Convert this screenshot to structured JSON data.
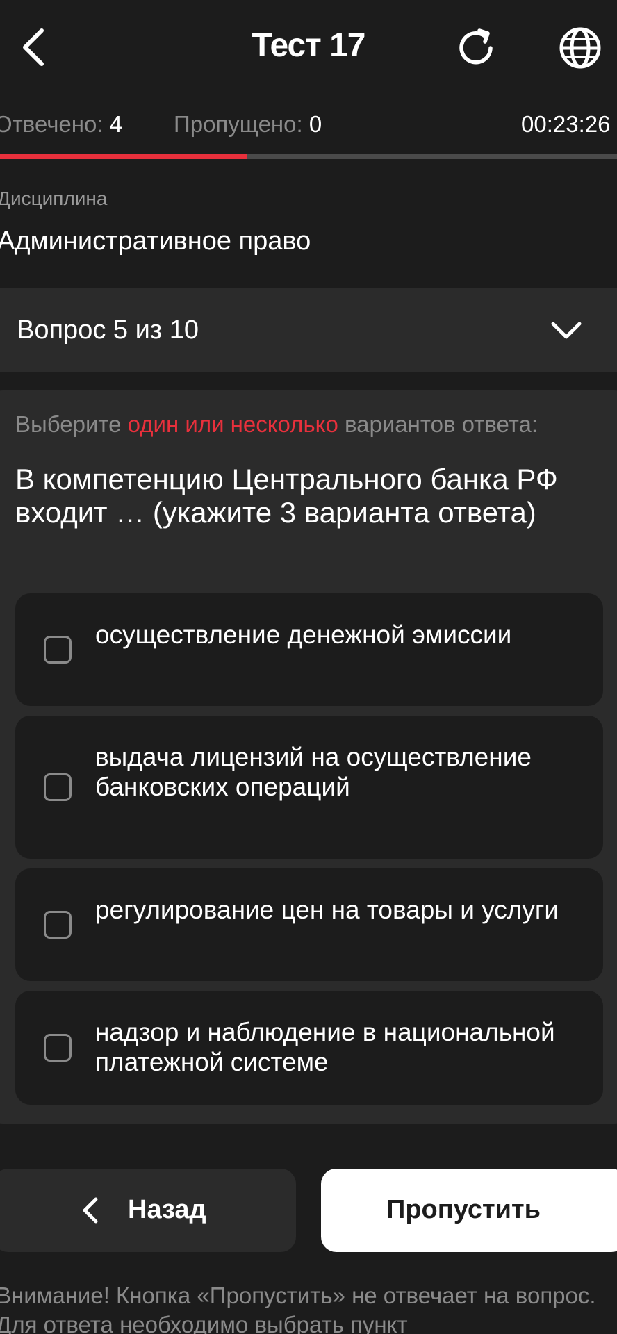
{
  "header": {
    "title": "Тест 17",
    "back_icon": "chevron-left-icon",
    "refresh_icon": "refresh-icon",
    "globe_icon": "globe-icon"
  },
  "status": {
    "answered_label": "Отвечено:",
    "answered_value": "4",
    "skipped_label": "Пропущено:",
    "skipped_value": "0",
    "timer": "00:23:26",
    "progress_fraction": 0.4
  },
  "discipline": {
    "label": "Дисциплина",
    "value": "Административное право"
  },
  "question_selector": {
    "label": "Вопрос 5 из 10"
  },
  "question": {
    "instruction_before": "Выберите ",
    "instruction_accent": "один или несколько",
    "instruction_after": " вариантов ответа:",
    "text": "В компетенцию Центрального банка РФ входит … (укажите 3 варианта ответа)",
    "options": [
      {
        "text": "осуществление денежной эмиссии",
        "checked": false
      },
      {
        "text": "выдача лицензий на осуществление банковских операций",
        "checked": false
      },
      {
        "text": "регулирование цен на товары и услуги",
        "checked": false
      },
      {
        "text": "надзор и наблюдение в национальной платежной системе",
        "checked": false
      }
    ]
  },
  "buttons": {
    "back_label": "Назад",
    "skip_label": "Пропустить"
  },
  "notice": "Внимание! Кнопка «Пропустить» не отвечает на вопрос. Для ответа необходимо выбрать пункт",
  "colors": {
    "background": "#1c1c1c",
    "card": "#2b2b2b",
    "accent": "#e8303c",
    "muted": "#8a8a8a"
  }
}
